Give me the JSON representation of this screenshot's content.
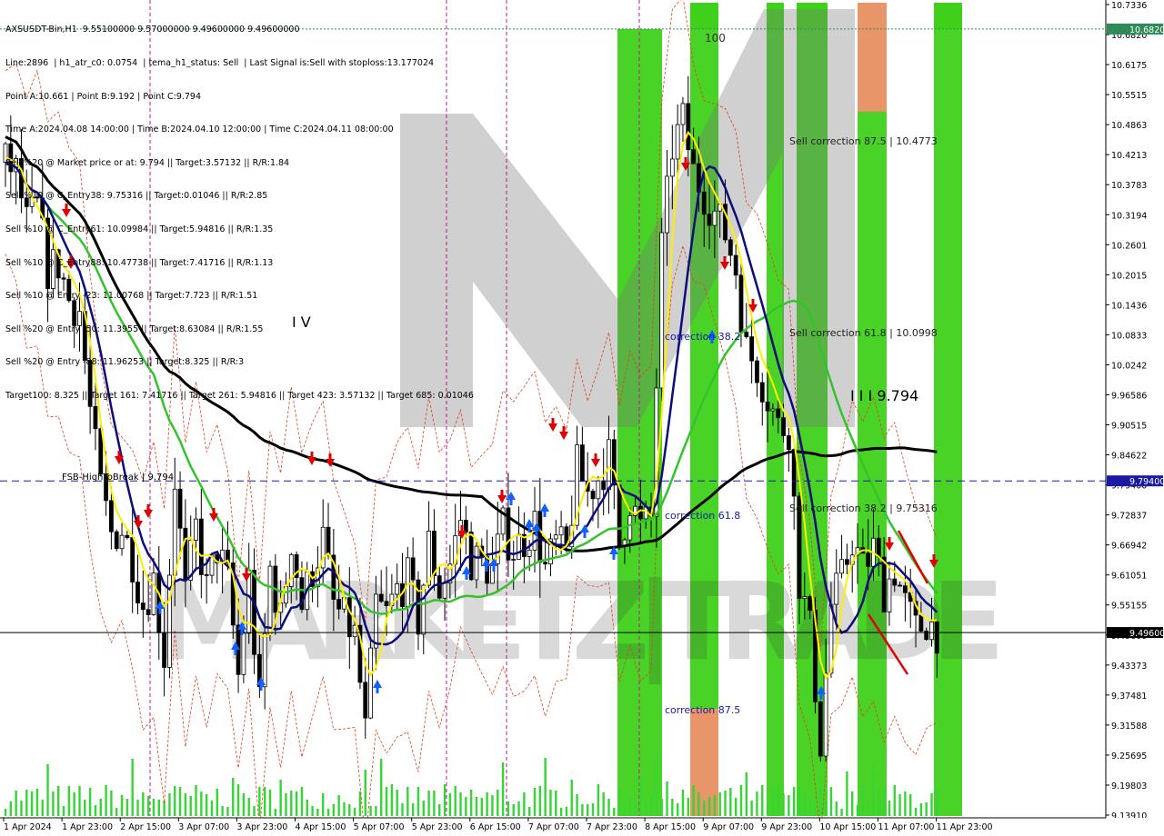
{
  "header": {
    "lines": [
      "AXSUSDT-Bin,H1  9.55100000 9.57000000 9.49600000 9.49600000",
      "Line:2896  | h1_atr_c0: 0.0754  | tema_h1_status: Sell  | Last Signal is:Sell with stoploss:13.177024",
      "Point A:10.661 | Point B:9.192 | Point C:9.794",
      "Time A:2024.04.08 14:00:00 | Time B:2024.04.10 12:00:00 | Time C:2024.04.11 08:00:00",
      "Sell %20 @ Market price or at: 9.794 || Target:3.57132 || R/R:1.84",
      "Sell %10 @ C_Entry38: 9.75316 || Target:0.01046 || R/R:2.85",
      "Sell %10 @ C_Entry61: 10.09984 || Target:5.94816 || R/R:1.35",
      "Sell %10 @ C_Entry88: 10.47738 || Target:7.41716 || R/R:1.13",
      "Sell %10 @ Entry -23: 11.00768 || Target:7.723 || R/R:1.51",
      "Sell %20 @ Entry -50: 11.3955 || Target:8.63084 || R/R:1.55",
      "Sell %20 @ Entry -88: 11.96253 || Target:8.325 || R/R:3",
      "Target100: 8.325 || Target 161: 7.41716 || Target 261: 5.94816 || Target 423: 3.57132 || Target 685: 0.01046"
    ]
  },
  "watermark": "MARKETZ|TRADE",
  "price_axis": {
    "ticks": [
      "10.7336",
      "10.6820",
      "10.6175",
      "10.5515",
      "10.4863",
      "10.4213",
      "10.3783",
      "10.3194",
      "10.2601",
      "10.2015",
      "10.1436",
      "10.0833",
      "10.0242",
      "9.96586",
      "9.90515",
      "9.84622",
      "9.79400",
      "9.72837",
      "9.66942",
      "9.61051",
      "9.55155",
      "9.49600",
      "9.43373",
      "9.37481",
      "9.31588",
      "9.25695",
      "9.19803",
      "9.13910"
    ],
    "highlight_levels": [
      {
        "label": "10.6820",
        "value": 10.682,
        "color": "#2e8b57",
        "style": "dotted"
      },
      {
        "label": "9.79400",
        "value": 9.794,
        "color": "#1a1aa6",
        "style": "dashed"
      },
      {
        "label": "9.49600",
        "value": 9.496,
        "color": "#000000",
        "style": "solid"
      }
    ]
  },
  "time_axis": {
    "labels": [
      "1 Apr 2024",
      "1 Apr 23:00",
      "2 Apr 15:00",
      "3 Apr 07:00",
      "3 Apr 23:00",
      "4 Apr 15:00",
      "5 Apr 07:00",
      "5 Apr 23:00",
      "6 Apr 15:00",
      "7 Apr 07:00",
      "7 Apr 23:00",
      "8 Apr 15:00",
      "9 Apr 07:00",
      "9 Apr 23:00",
      "10 Apr 15:00",
      "11 Apr 07:00",
      "11 Apr 23:00"
    ]
  },
  "annotations": {
    "label_100": "100",
    "wave_iv": "I V",
    "wave_iii": "I I I 9.794",
    "fsb": "FSB-HighToBreak | 9.794",
    "sell_corr_875": "Sell correction 87.5 | 10.4773",
    "sell_corr_618": "Sell correction 61.8 | 10.0998",
    "sell_corr_382": "Sell correction 38.2 | 9.75316",
    "corr_382": "correction 38.2",
    "corr_618": "correction 61.8",
    "corr_875": "correction 87.5"
  },
  "colors": {
    "green_zone": "#3fd11a",
    "orange_zone": "#e8956a",
    "ema_black": "#000000",
    "ema_green": "#33c42b",
    "ema_navy": "#0d0d7a",
    "line_yellow": "#ffee00",
    "band_red": "#e0401a",
    "volume": "#33d633",
    "sell_arrow": "#e00000",
    "buy_arrow": "#1060ff",
    "candle": "#000000"
  },
  "chart_data": {
    "type": "candlestick",
    "symbol": "AXSUSDT-Bin",
    "timeframe": "H1",
    "ylim": [
      9.139,
      10.7336
    ],
    "close_path": [
      [
        0,
        10.42
      ],
      [
        2,
        10.4
      ],
      [
        4,
        10.3
      ],
      [
        6,
        10.33
      ],
      [
        8,
        10.21
      ],
      [
        10,
        10.22
      ],
      [
        12,
        10.15
      ],
      [
        14,
        10.13
      ],
      [
        16,
        9.93
      ],
      [
        18,
        9.78
      ],
      [
        20,
        9.69
      ],
      [
        22,
        9.7
      ],
      [
        24,
        9.64
      ],
      [
        26,
        9.55
      ],
      [
        28,
        9.6
      ],
      [
        30,
        9.45
      ],
      [
        32,
        9.8
      ],
      [
        34,
        9.57
      ],
      [
        36,
        9.7
      ],
      [
        38,
        9.58
      ],
      [
        40,
        9.66
      ],
      [
        42,
        9.6
      ],
      [
        44,
        9.41
      ],
      [
        46,
        9.6
      ],
      [
        48,
        9.35
      ],
      [
        50,
        9.62
      ],
      [
        52,
        9.52
      ],
      [
        54,
        9.68
      ],
      [
        56,
        9.55
      ],
      [
        58,
        9.62
      ],
      [
        60,
        9.68
      ],
      [
        62,
        9.55
      ],
      [
        64,
        9.52
      ],
      [
        66,
        9.49
      ],
      [
        68,
        9.3
      ],
      [
        70,
        9.55
      ],
      [
        72,
        9.53
      ],
      [
        74,
        9.58
      ],
      [
        76,
        9.6
      ],
      [
        78,
        9.52
      ],
      [
        80,
        9.67
      ],
      [
        82,
        9.58
      ],
      [
        84,
        9.63
      ],
      [
        86,
        9.72
      ],
      [
        88,
        9.64
      ],
      [
        90,
        9.63
      ],
      [
        92,
        9.62
      ],
      [
        94,
        9.7
      ],
      [
        96,
        9.66
      ],
      [
        98,
        9.68
      ],
      [
        100,
        9.71
      ],
      [
        102,
        9.62
      ],
      [
        104,
        9.67
      ],
      [
        106,
        9.65
      ],
      [
        108,
        9.82
      ],
      [
        110,
        9.77
      ],
      [
        112,
        9.8
      ],
      [
        114,
        9.84
      ],
      [
        116,
        9.67
      ],
      [
        118,
        9.76
      ],
      [
        120,
        9.7
      ],
      [
        122,
        9.72
      ],
      [
        124,
        10.25
      ],
      [
        126,
        10.45
      ],
      [
        128,
        10.5
      ],
      [
        130,
        10.4
      ],
      [
        132,
        10.36
      ],
      [
        134,
        10.32
      ],
      [
        136,
        10.28
      ],
      [
        138,
        10.21
      ],
      [
        140,
        10.05
      ],
      [
        142,
        10.02
      ],
      [
        144,
        9.96
      ],
      [
        146,
        9.9
      ],
      [
        148,
        9.9
      ],
      [
        150,
        9.6
      ],
      [
        152,
        9.5
      ],
      [
        154,
        9.28
      ],
      [
        156,
        9.55
      ],
      [
        158,
        9.6
      ],
      [
        160,
        9.68
      ],
      [
        162,
        9.62
      ],
      [
        164,
        9.66
      ],
      [
        166,
        9.58
      ],
      [
        168,
        9.62
      ],
      [
        170,
        9.55
      ],
      [
        172,
        9.5
      ],
      [
        174,
        9.52
      ],
      [
        176,
        9.5
      ]
    ],
    "levels": [
      {
        "name": "Point A",
        "value": 10.661
      },
      {
        "name": "Point B",
        "value": 9.192
      },
      {
        "name": "Point C",
        "value": 9.794
      },
      {
        "name": "FSB-HighToBreak",
        "value": 9.794
      },
      {
        "name": "Last price",
        "value": 9.496
      }
    ]
  }
}
